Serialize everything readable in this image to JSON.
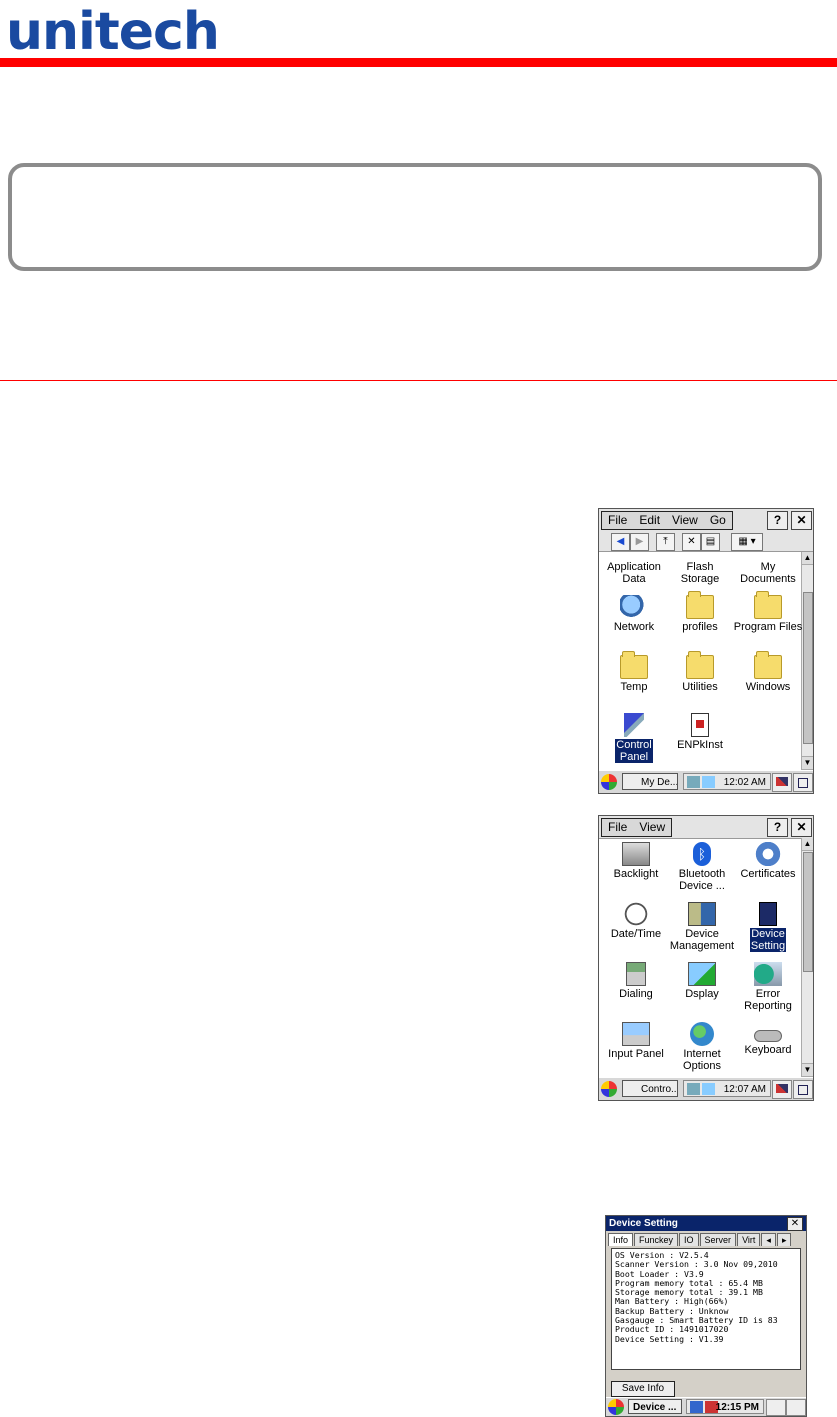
{
  "header": {
    "logo_text": "unitech",
    "brand_color": "#1a4aa0",
    "accent_color": "#ff0000"
  },
  "screen1": {
    "menu": [
      "File",
      "Edit",
      "View",
      "Go"
    ],
    "help": "?",
    "close": "✕",
    "icons": [
      {
        "label": "Application\nData",
        "icon": "folder-icon"
      },
      {
        "label": "Flash\nStorage",
        "icon": "folder-icon"
      },
      {
        "label": "My\nDocuments",
        "icon": "folder-icon"
      },
      {
        "label": "Network",
        "icon": "network-icon"
      },
      {
        "label": "profiles",
        "icon": "folder-icon"
      },
      {
        "label": "Program Files",
        "icon": "folder-icon"
      },
      {
        "label": "Temp",
        "icon": "folder-icon"
      },
      {
        "label": "Utilities",
        "icon": "folder-icon"
      },
      {
        "label": "Windows",
        "icon": "folder-icon"
      },
      {
        "label": "Control\nPanel",
        "icon": "control-panel-icon",
        "selected": true
      },
      {
        "label": "ENPkInst",
        "icon": "file-icon"
      }
    ],
    "task_label": "My De...",
    "time": "12:02 AM"
  },
  "screen2": {
    "menu": [
      "File",
      "View"
    ],
    "help": "?",
    "close": "✕",
    "icons": [
      {
        "label": "Backlight",
        "icon": "backlight-icon"
      },
      {
        "label": "Bluetooth\nDevice ...",
        "icon": "bluetooth-icon"
      },
      {
        "label": "Certificates",
        "icon": "certificates-icon"
      },
      {
        "label": "Date/Time",
        "icon": "clock-icon"
      },
      {
        "label": "Device\nManagement",
        "icon": "device-management-icon"
      },
      {
        "label": "Device\nSetting",
        "icon": "device-setting-icon",
        "selected": true
      },
      {
        "label": "Dialing",
        "icon": "phone-icon"
      },
      {
        "label": "Dsplay",
        "icon": "display-icon"
      },
      {
        "label": "Error\nReporting",
        "icon": "error-reporting-icon"
      },
      {
        "label": "Input Panel",
        "icon": "input-panel-icon"
      },
      {
        "label": "Internet\nOptions",
        "icon": "globe-icon"
      },
      {
        "label": "Keyboard",
        "icon": "keyboard-icon"
      }
    ],
    "task_label": "Contro...",
    "time": "12:07 AM"
  },
  "screen3": {
    "title": "Device Setting",
    "close": "✕",
    "tabs": [
      "Info",
      "Funckey",
      "IO",
      "Server",
      "Virt"
    ],
    "info_lines": [
      "OS Version : V2.5.4",
      "Scanner Version : 3.0 Nov 09,2010",
      "Boot Loader : V3.9",
      "Program memory total : 65.4 MB",
      "Storage memory total : 39.1 MB",
      "Man Battery : High(66%)",
      "Backup Battery : Unknow",
      "Gasgauge : Smart Battery ID is 83",
      "Product ID : 1491017020",
      "Device Setting : V1.39"
    ],
    "save_button": "Save Info",
    "task_label": "Device ...",
    "time": "12:15 PM"
  }
}
